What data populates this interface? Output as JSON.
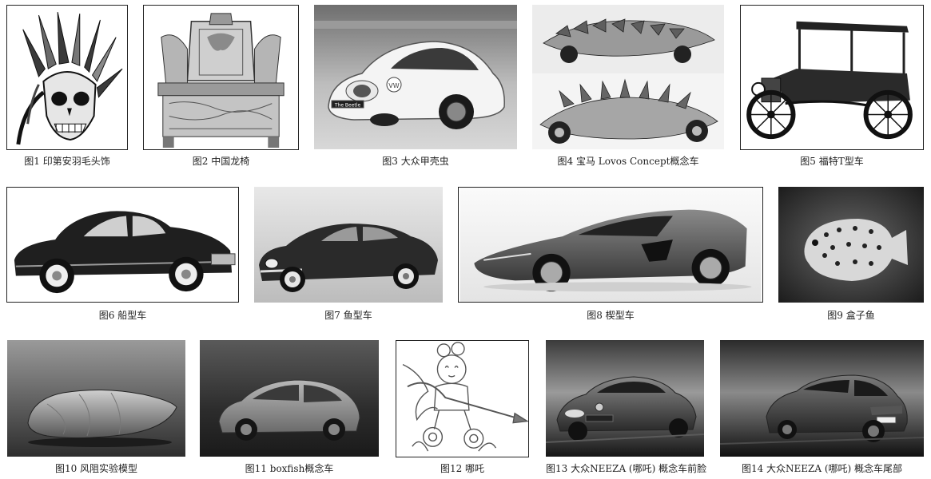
{
  "figures": [
    {
      "caption": "图1 印第安羽毛头饰",
      "icon": "indian-feather-headdress-skull-image"
    },
    {
      "caption": "图2 中国龙椅",
      "icon": "chinese-dragon-throne-image"
    },
    {
      "caption": "图3 大众甲壳虫",
      "icon": "vw-beetle-car-image",
      "plate": "The Beetle"
    },
    {
      "caption": "图4 宝马 Lovos Concept概念车",
      "icon": "bmw-lovos-concept-car-image"
    },
    {
      "caption": "图5 福特T型车",
      "icon": "ford-model-t-image"
    },
    {
      "caption": "图6 船型车",
      "icon": "ship-shaped-car-image"
    },
    {
      "caption": "图7 鱼型车",
      "icon": "fish-shaped-car-image"
    },
    {
      "caption": "图8 楔型车",
      "icon": "wedge-shaped-car-image"
    },
    {
      "caption": "图9 盒子鱼",
      "icon": "boxfish-image"
    },
    {
      "caption": "图10 风阻实验模型",
      "icon": "wind-resistance-model-image"
    },
    {
      "caption": "图11 boxfish概念车",
      "icon": "boxfish-concept-car-image"
    },
    {
      "caption": "图12 哪吒",
      "icon": "nezha-drawing-image"
    },
    {
      "caption": "图13 大众NEEZA (哪吒) 概念车前脸",
      "icon": "neeza-concept-front-image"
    },
    {
      "caption": "图14 大众NEEZA (哪吒) 概念车尾部",
      "icon": "neeza-concept-rear-image"
    }
  ]
}
